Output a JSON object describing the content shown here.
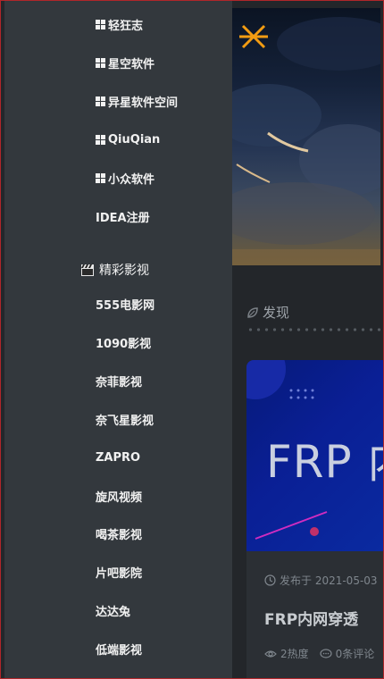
{
  "sidebar": {
    "software_items": [
      {
        "label": "轻狂志",
        "icon": "windows-icon"
      },
      {
        "label": "星空软件",
        "icon": "windows-icon"
      },
      {
        "label": "异星软件空间",
        "icon": "windows-icon"
      },
      {
        "label": "QiuQian",
        "icon": "windows-icon"
      },
      {
        "label": "小众软件",
        "icon": "windows-icon"
      },
      {
        "label": "IDEA注册",
        "icon": ""
      }
    ],
    "section": {
      "title": "精彩影视",
      "icon": "clapperboard-icon"
    },
    "video_items": [
      {
        "label": "555电影网"
      },
      {
        "label": "1090影视"
      },
      {
        "label": "奈菲影视"
      },
      {
        "label": "奈飞星影视"
      },
      {
        "label": "ZAPRO"
      },
      {
        "label": "旋风视频"
      },
      {
        "label": "喝茶影视"
      },
      {
        "label": "片吧影院"
      },
      {
        "label": "达达兔"
      },
      {
        "label": "低端影视"
      }
    ]
  },
  "content": {
    "close_icon": "close-icon",
    "close_color": "#f39c12",
    "discover_label": "发现",
    "card": {
      "image_text": "FRP 内",
      "date_label": "发布于 2021-05-03",
      "title": "FRP内网穿透",
      "heat": "2热度",
      "comments": "0条评论"
    }
  },
  "colors": {
    "sidebar_bg": "#33383d",
    "content_bg": "#23262a",
    "accent": "#f39c12",
    "frame_border": "#b0262a"
  }
}
